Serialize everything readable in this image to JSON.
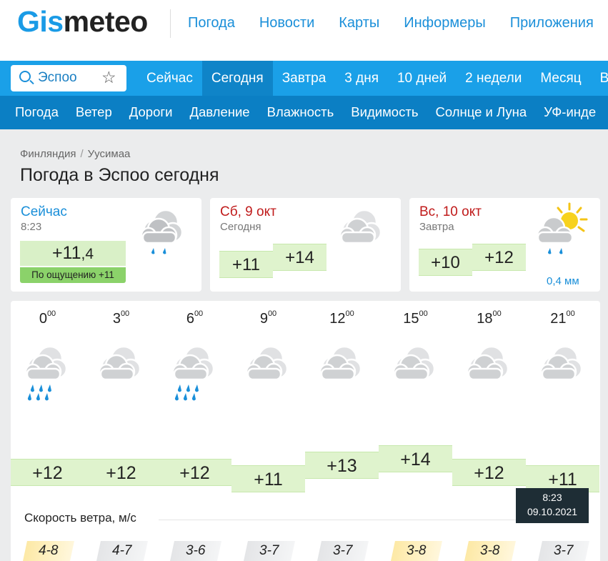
{
  "brand": {
    "logo_part1": "Gis",
    "logo_part2": "meteo"
  },
  "topnav": [
    "Погода",
    "Новости",
    "Карты",
    "Информеры",
    "Приложения"
  ],
  "search": {
    "city": "Эспоо"
  },
  "tabs": [
    "Сейчас",
    "Сегодня",
    "Завтра",
    "3 дня",
    "10 дней",
    "2 недели",
    "Месяц",
    "В"
  ],
  "active_tab": "Сегодня",
  "subtabs": [
    "Погода",
    "Ветер",
    "Дороги",
    "Давление",
    "Влажность",
    "Видимость",
    "Солнце и Луна",
    "УФ-инде"
  ],
  "breadcrumb": {
    "country": "Финляндия",
    "separator": "/",
    "region": "Уусимаа"
  },
  "page_title": "Погода в Эспоо сегодня",
  "now": {
    "title": "Сейчас",
    "time": "8:23",
    "temp_int": "+11",
    "temp_frac": ",4",
    "feels": "По ощущению +11",
    "icon": "cloud-rain-icon"
  },
  "today": {
    "title": "Сб, 9 окт",
    "sub": "Сегодня",
    "t_min": "+11",
    "t_max": "+14",
    "icon": "cloud-icon"
  },
  "tomorrow": {
    "title": "Вс, 10 окт",
    "sub": "Завтра",
    "t_min": "+10",
    "t_max": "+12",
    "precip": "0,4 мм",
    "icon": "sun-cloud-rain-icon"
  },
  "hourly": [
    {
      "hour": "0",
      "min": "00",
      "temp": "+12",
      "icon": "cloud-rain-icon",
      "temp_value": 12
    },
    {
      "hour": "3",
      "min": "00",
      "temp": "+12",
      "icon": "cloud-icon",
      "temp_value": 12
    },
    {
      "hour": "6",
      "min": "00",
      "temp": "+12",
      "icon": "cloud-rain-icon",
      "temp_value": 12
    },
    {
      "hour": "9",
      "min": "00",
      "temp": "+11",
      "icon": "cloud-icon",
      "temp_value": 11
    },
    {
      "hour": "12",
      "min": "00",
      "temp": "+13",
      "icon": "cloud-icon",
      "temp_value": 13
    },
    {
      "hour": "15",
      "min": "00",
      "temp": "+14",
      "icon": "cloud-icon",
      "temp_value": 14
    },
    {
      "hour": "18",
      "min": "00",
      "temp": "+12",
      "icon": "cloud-icon",
      "temp_value": 12
    },
    {
      "hour": "21",
      "min": "00",
      "temp": "+11",
      "icon": "cloud-icon",
      "temp_value": 11
    }
  ],
  "tooltip": {
    "time": "8:23",
    "date": "09.10.2021"
  },
  "wind": {
    "label": "Скорость ветра, м/с",
    "values": [
      "4-8",
      "4-7",
      "3-6",
      "3-7",
      "3-7",
      "3-8",
      "3-8",
      "3-7"
    ],
    "highlight": [
      true,
      false,
      false,
      false,
      false,
      true,
      true,
      false
    ]
  },
  "colors": {
    "brand_blue": "#1a9be6",
    "nav_bar": "#1aa0e8",
    "subnav_bar": "#0b7fc4",
    "temp_green": "#dff3cd",
    "feels_green": "#8bd26a"
  }
}
